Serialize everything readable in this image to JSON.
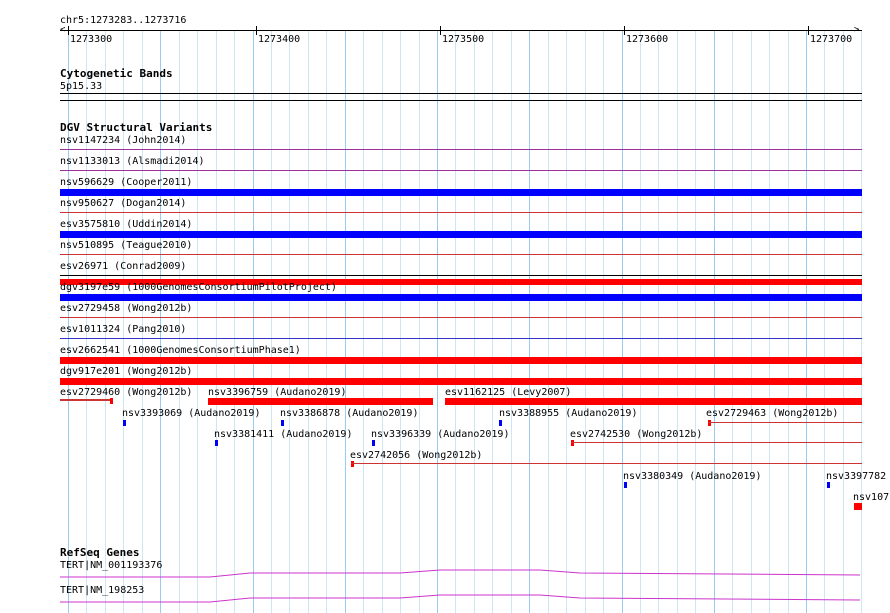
{
  "region_label": "chr5:1273283..1273716",
  "ruler": {
    "start": 1273283,
    "end": 1273716,
    "ticks": [
      "1273300",
      "1273400",
      "1273500",
      "1273600",
      "1273700"
    ]
  },
  "tracks": {
    "cytoband": {
      "title": "Cytogenetic Bands",
      "band": "5p15.33"
    },
    "dgv": {
      "title": "DGV Structural Variants",
      "colors": {
        "loss": "#ff0000",
        "gain": "#0000ff",
        "complex": "#993399",
        "line_gain": "#3333cc",
        "line_loss": "#cc3333"
      },
      "full_rows": [
        {
          "label": "nsv1147234 (John2014)",
          "style": "line",
          "color": "#993399"
        },
        {
          "label": "nsv1133013 (Alsmadi2014)",
          "style": "line",
          "color": "#993399"
        },
        {
          "label": "nsv596629 (Cooper2011)",
          "style": "bar",
          "color": "#0000ff"
        },
        {
          "label": "nsv950627 (Dogan2014)",
          "style": "line",
          "color": "#cc3333"
        },
        {
          "label": "esv3575810 (Uddin2014)",
          "style": "bar",
          "color": "#0000ff"
        },
        {
          "label": "nsv510895 (Teague2010)",
          "style": "line",
          "color": "#cc3333"
        },
        {
          "label": "esv26971 (Conrad2009)",
          "style": "line",
          "color": "#000000",
          "bar_below": "#ff0000"
        },
        {
          "label": "dgv3197e59 (1000GenomesConsortiumPilotProject)",
          "style": "bar",
          "color": "#0000ff"
        },
        {
          "label": "esv2729458 (Wong2012b)",
          "style": "line",
          "color": "#cc3333"
        },
        {
          "label": "esv1011324 (Pang2010)",
          "style": "line",
          "color": "#3333cc"
        },
        {
          "label": "esv2662541 (1000GenomesConsortiumPhase1)",
          "style": "bar",
          "color": "#ff0000"
        },
        {
          "label": "dgv917e201 (Wong2012b)",
          "style": "bar",
          "color": "#ff0000"
        }
      ],
      "packed": [
        {
          "label": "esv2729460 (Wong2012b)"
        },
        {
          "label": "nsv3396759 (Audano2019)"
        },
        {
          "label": "esv1162125 (Levy2007)"
        },
        {
          "label": "nsv3393069 (Audano2019)"
        },
        {
          "label": "nsv3386878 (Audano2019)"
        },
        {
          "label": "nsv3388955 (Audano2019)"
        },
        {
          "label": "esv2729463 (Wong2012b)"
        },
        {
          "label": "nsv3381411 (Audano2019)"
        },
        {
          "label": "nsv3396339 (Audano2019)"
        },
        {
          "label": "esv2742530 (Wong2012b)"
        },
        {
          "label": "esv2742056 (Wong2012b)"
        },
        {
          "label": "nsv3380349 (Audano2019)"
        },
        {
          "label": "nsv3397782"
        },
        {
          "label": "nsv107"
        }
      ]
    },
    "refseq": {
      "title": "RefSeq Genes",
      "color": "#cc33cc",
      "genes": [
        {
          "label": "TERT|NM_001193376"
        },
        {
          "label": "TERT|NM_198253"
        }
      ]
    }
  }
}
